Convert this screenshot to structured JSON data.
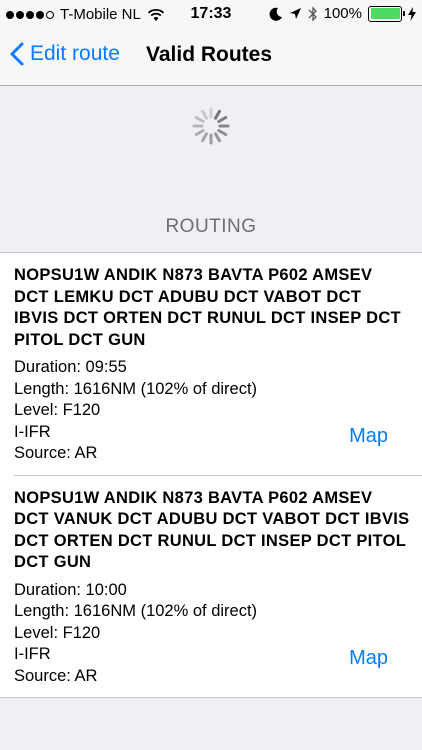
{
  "status": {
    "carrier": "T-Mobile NL",
    "time": "17:33",
    "battery": "100%",
    "battery_fraction": 1.0,
    "signal_bars": 4,
    "signal_max": 5
  },
  "navbar": {
    "back_label": "Edit route",
    "title": "Valid Routes"
  },
  "section": {
    "header": "ROUTING"
  },
  "routes": [
    {
      "route": "NOPSU1W ANDIK N873 BAVTA P602 AMSEV DCT LEMKU DCT ADUBU DCT VABOT DCT IBVIS DCT ORTEN DCT RUNUL DCT INSEP DCT PITOL DCT GUN",
      "duration": "Duration: 09:55",
      "length": "Length: 1616NM (102% of direct)",
      "level": "Level: F120",
      "rules": "I-IFR",
      "source": "Source: AR",
      "map_label": "Map"
    },
    {
      "route": "NOPSU1W ANDIK N873 BAVTA P602 AMSEV DCT VANUK DCT ADUBU DCT VABOT DCT IBVIS DCT ORTEN DCT RUNUL DCT INSEP DCT PITOL DCT GUN",
      "duration": "Duration: 10:00",
      "length": "Length: 1616NM (102% of direct)",
      "level": "Level: F120",
      "rules": "I-IFR",
      "source": "Source: AR",
      "map_label": "Map"
    }
  ],
  "colors": {
    "accent": "#0a7aff",
    "battery": "#4cd964",
    "background": "#efeff4"
  }
}
